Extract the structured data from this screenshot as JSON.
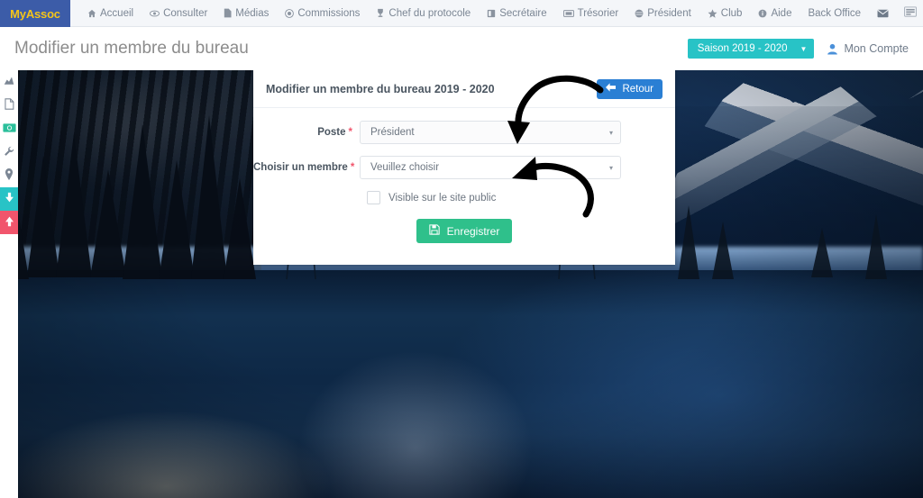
{
  "navbar": {
    "brand": "MyAssoc",
    "items": [
      {
        "label": "Accueil",
        "icon": "home-icon",
        "glyph": "⌂"
      },
      {
        "label": "Consulter",
        "icon": "eye-icon",
        "glyph": "◉"
      },
      {
        "label": "Médias",
        "icon": "file-icon",
        "glyph": "▤"
      },
      {
        "label": "Commissions",
        "icon": "badge-icon",
        "glyph": "◉"
      },
      {
        "label": "Chef du protocole",
        "icon": "trophy-icon",
        "glyph": "♗"
      },
      {
        "label": "Secrétaire",
        "icon": "book-icon",
        "glyph": "▥"
      },
      {
        "label": "Trésorier",
        "icon": "money-icon",
        "glyph": "▤"
      },
      {
        "label": "Président",
        "icon": "globe-icon",
        "glyph": "◔"
      },
      {
        "label": "Club",
        "icon": "star-icon",
        "glyph": "★"
      },
      {
        "label": "Aide",
        "icon": "info-icon",
        "glyph": "ⓘ"
      },
      {
        "label": "Back Office",
        "icon": "none",
        "glyph": ""
      }
    ],
    "mail_icon": "envelope-icon",
    "mail_glyph": "✉",
    "right_icon": "list-panel-icon",
    "right_glyph": "▤"
  },
  "header": {
    "title": "Modifier un membre du bureau",
    "season_label": "Saison 2019 - 2020",
    "season_caret": "▼",
    "account_label": "Mon Compte",
    "account_glyph": "♟"
  },
  "rail": {
    "items": [
      {
        "name": "chart-icon",
        "glyph": "◰",
        "style": ""
      },
      {
        "name": "document-icon",
        "glyph": "▧",
        "style": ""
      },
      {
        "name": "money-bill-icon",
        "glyph": "▤",
        "style": "money"
      },
      {
        "name": "wrench-icon",
        "glyph": "⚒",
        "style": ""
      },
      {
        "name": "map-pin-icon",
        "glyph": "⊙",
        "style": ""
      },
      {
        "name": "arrow-down-icon",
        "glyph": "⬇",
        "style": "teal"
      },
      {
        "name": "arrow-up-icon",
        "glyph": "⬆",
        "style": "red"
      }
    ]
  },
  "card": {
    "title": "Modifier un membre du bureau 2019 - 2020",
    "back_button": "Retour",
    "back_glyph": "←",
    "fields": [
      {
        "label": "Poste",
        "required": "*",
        "value": "Président",
        "caret": "▾",
        "name": "poste-select"
      },
      {
        "label": "Choisir un membre",
        "required": "*",
        "value": "Veuillez choisir",
        "caret": "▾",
        "name": "membre-select"
      }
    ],
    "checkbox_label": "Visible sur le site public",
    "checkbox_checked": "false",
    "save_button": "Enregistrer",
    "save_glyph": "ὋE"
  },
  "colors": {
    "brand_bg": "#3c5ca8",
    "brand_text": "#f5c518",
    "teal": "#28c3c6",
    "blue": "#2a7fd4",
    "green": "#2fc08b",
    "red": "#f1556c",
    "navbar_bg": "#f4f6f9"
  },
  "background": {
    "description": "winter night forest lake with snowy mountain"
  }
}
